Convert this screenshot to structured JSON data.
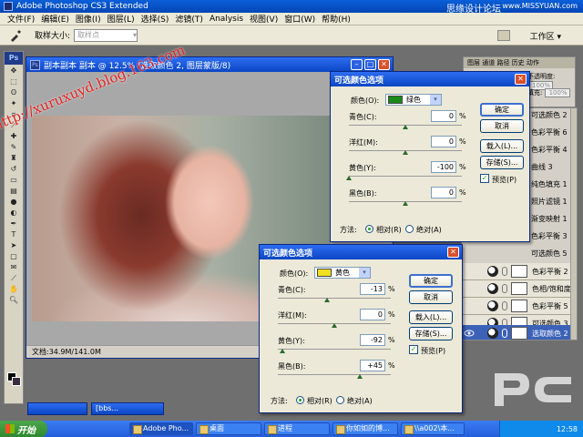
{
  "app": {
    "title": "Adobe Photoshop CS3 Extended",
    "watermark_top": "思缘设计论坛",
    "watermark_top_url": "www.MISSYUAN.com"
  },
  "menu": [
    "文件(F)",
    "编辑(E)",
    "图像(I)",
    "图层(L)",
    "选择(S)",
    "滤镜(T)",
    "Analysis",
    "视图(V)",
    "窗口(W)",
    "帮助(H)"
  ],
  "options": {
    "sample_size_label": "取样大小:",
    "sample_size_value": "取样点",
    "workspace_label": "工作区 ▾"
  },
  "document": {
    "title": "副本副本 副本 @ 12.5% (选取颜色 2, 图层蒙版/8)",
    "status": "文档:34.9M/141.0M",
    "watermark_url": "http://xuruxuyd.blog.163.com"
  },
  "nav_panel": {
    "tabs": "图层  通道  路径  历史  动作",
    "opacity_label": "不透明度:",
    "opacity_value": "100%",
    "fill_label": "填充:",
    "fill_value": "100%"
  },
  "layers": {
    "partial_items": [
      "可选颜色 2",
      "色彩平衡 6",
      "色彩平衡 4",
      "曲线 3",
      "纯色填充 1",
      "照片滤镜 1",
      "渐变映射 1",
      "色彩平衡 3",
      "可选颜色 5"
    ],
    "items": [
      {
        "name": "色彩平衡 2",
        "selected": false
      },
      {
        "name": "色相/饱和度...",
        "selected": false
      },
      {
        "name": "色彩平衡 5",
        "selected": false
      },
      {
        "name": "可选颜色 3",
        "selected": false
      },
      {
        "name": "选取颜色 2",
        "selected": true
      }
    ]
  },
  "dialog1": {
    "title": "可选颜色选项",
    "colors_label": "颜色(O):",
    "color_value": "绿色",
    "color_swatch": "#1a8a1a",
    "rows": [
      {
        "label": "青色(C):",
        "value": "0",
        "frac": 0.5
      },
      {
        "label": "洋红(M):",
        "value": "0",
        "frac": 0.5
      },
      {
        "label": "黄色(Y):",
        "value": "-100",
        "frac": 0.0
      },
      {
        "label": "黑色(B):",
        "value": "0",
        "frac": 0.5
      }
    ],
    "pct": "%",
    "ok": "确定",
    "cancel": "取消",
    "load": "载入(L)...",
    "save": "存储(S)...",
    "preview": "预览(P)",
    "method_label": "方法:",
    "relative": "相对(R)",
    "absolute": "绝对(A)"
  },
  "dialog2": {
    "title": "可选颜色选项",
    "colors_label": "颜色(O):",
    "color_value": "黄色",
    "color_swatch": "#f0e020",
    "rows": [
      {
        "label": "青色(C):",
        "value": "-13",
        "frac": 0.435
      },
      {
        "label": "洋红(M):",
        "value": "0",
        "frac": 0.5
      },
      {
        "label": "黄色(Y):",
        "value": "-92",
        "frac": 0.04
      },
      {
        "label": "黑色(B):",
        "value": "+45",
        "frac": 0.725
      }
    ],
    "pct": "%",
    "ok": "确定",
    "cancel": "取消",
    "load": "载入(L)...",
    "save": "存储(S)...",
    "preview": "预览(P)",
    "method_label": "方法:",
    "relative": "相对(R)",
    "absolute": "绝对(A)"
  },
  "minidocs": [
    "",
    "[bbs..."
  ],
  "taskbar": {
    "start": "开始",
    "tasks": [
      "Adobe Pho...",
      "桌面",
      "进程",
      "你如如的博...",
      "\\\\a002\\本..."
    ],
    "time": "12:58"
  },
  "colors": {
    "accent": "#0b46c4",
    "selected_layer": "#3c62b8"
  }
}
